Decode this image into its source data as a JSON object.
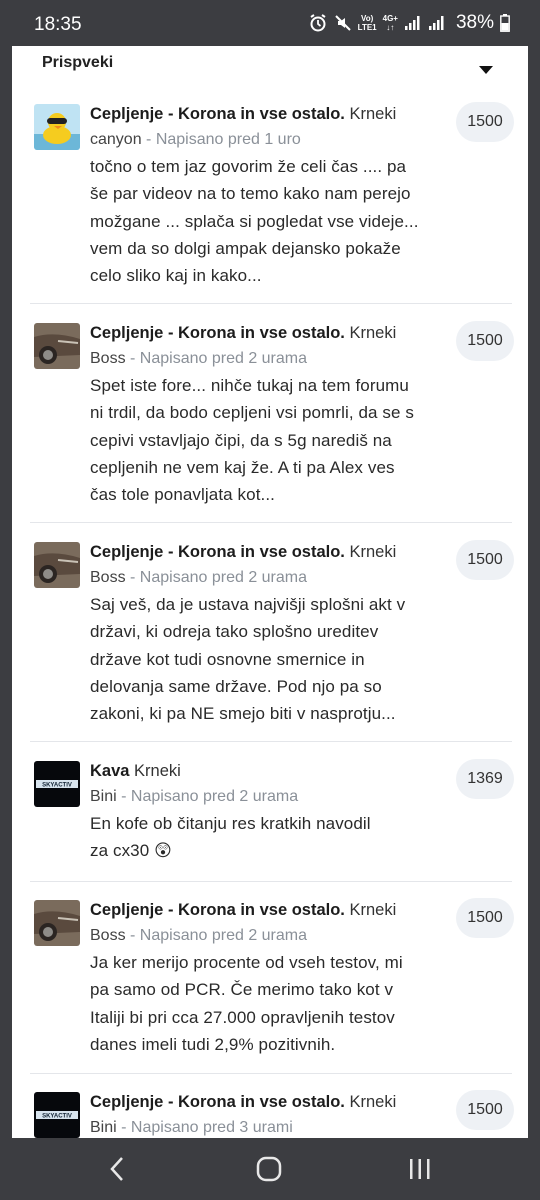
{
  "status": {
    "time": "18:35",
    "net_top": "Vo)",
    "net_bottom": "LTE1",
    "net2_top": "4G+",
    "battery": "38%"
  },
  "section": {
    "title": "Prispveki"
  },
  "posts": [
    {
      "title": "Cepljenje - Korona in vse ostalo.",
      "forum": "Krneki",
      "author": "canyon",
      "meta": " - Napisano pred 1 uro",
      "excerpt": "točno o tem jaz govorim že celi čas .... pa še par videov na to temo kako nam perejo možgane ...   splača si pogledat vse videje... vem da so dolgi ampak dejansko pokaže celo sliko kaj in kako...",
      "count": "1500",
      "avatar": "duck-avatar"
    },
    {
      "title": "Cepljenje - Korona in vse ostalo.",
      "forum": "Krneki",
      "author": "Boss",
      "meta": " - Napisano pred 2 urama",
      "excerpt": "Spet iste fore... nihče tukaj na tem forumu ni trdil, da bodo cepljeni vsi pomrli, da se s cepivi vstavljajo čipi, da s 5g narediš na cepljenih ne vem kaj že. A ti pa Alex ves čas tole ponavljata kot...",
      "count": "1500",
      "avatar": "car-avatar"
    },
    {
      "title": "Cepljenje - Korona in vse ostalo.",
      "forum": "Krneki",
      "author": "Boss",
      "meta": " - Napisano pred 2 urama",
      "excerpt": "Saj veš, da je ustava najvišji splošni akt v državi, ki odreja tako splošno ureditev države kot tudi osnovne smernice in delovanja same države. Pod njo pa so zakoni, ki pa NE smejo biti v nasprotju...",
      "count": "1500",
      "avatar": "car-avatar"
    },
    {
      "title": "Kava",
      "forum": "Krneki",
      "author": "Bini",
      "meta": " - Napisano pred 2 urama",
      "excerpt": "En kofe ob čitanju res kratkih navodil za cx30 😲",
      "count": "1369",
      "avatar": "skyactiv-avatar"
    },
    {
      "title": "Cepljenje - Korona in vse ostalo.",
      "forum": "Krneki",
      "author": "Boss",
      "meta": " - Napisano pred 2 urama",
      "excerpt": "Ja ker merijo procente od vseh testov, mi pa samo od PCR. Če merimo tako kot v Italiji bi pri cca 27.000 opravljenih testov danes imeli tudi 2,9% pozitivnih.",
      "count": "1500",
      "avatar": "car-avatar"
    },
    {
      "title": "Cepljenje - Korona in vse ostalo.",
      "forum": "Krneki",
      "author": "Bini",
      "meta": " - Napisano pred 3 urami",
      "excerpt": "",
      "count": "1500",
      "avatar": "skyactiv-avatar"
    }
  ],
  "avatar_labels": {
    "skyactiv": "SKYACTIV"
  },
  "colors": {
    "system_bar": "#3c3d41",
    "meta_text": "#8a9098",
    "count_bg": "#eef1f5"
  }
}
